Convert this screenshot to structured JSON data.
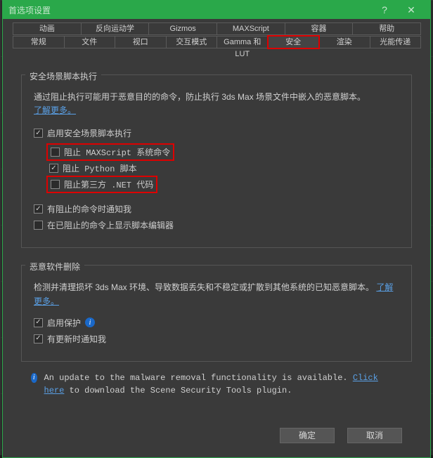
{
  "title": "首选项设置",
  "help_symbol": "?",
  "close_symbol": "✕",
  "tabs_row1": [
    "动画",
    "反向运动学",
    "Gizmos",
    "MAXScript",
    "容器",
    "帮助"
  ],
  "tabs_row2": [
    "常规",
    "文件",
    "视口",
    "交互模式",
    "Gamma 和 LUT",
    "安全",
    "渲染",
    "光能传递"
  ],
  "active_tab": "安全",
  "group1": {
    "title": "安全场景脚本执行",
    "desc": "通过阻止执行可能用于恶意目的的命令，防止执行 3ds Max 场景文件中嵌入的恶意脚本。",
    "learn_more": "了解更多。",
    "cb_enable": "启用安全场景脚本执行",
    "cb_block_maxscript": "阻止 MAXScript 系统命令",
    "cb_block_python": "阻止 Python 脚本",
    "cb_block_dotnet": "阻止第三方 .NET 代码",
    "cb_notify_block": "有阻止的命令时通知我",
    "cb_show_editor": "在已阻止的命令上显示脚本编辑器"
  },
  "group2": {
    "title": "恶意软件删除",
    "desc_a": "检测并清理损坏 3ds Max 环境、导致数据丢失和不稳定或扩散到其他系统的已知恶意脚本。",
    "learn_more": "了解更多。",
    "cb_protect": "启用保护",
    "cb_notify_update": "有更新时通知我"
  },
  "update_note_a": "An update to the malware removal functionality is available. ",
  "update_click": "Click here",
  "update_note_b": " to download the Scene Security Tools plugin.",
  "btn_ok": "确定",
  "btn_cancel": "取消"
}
